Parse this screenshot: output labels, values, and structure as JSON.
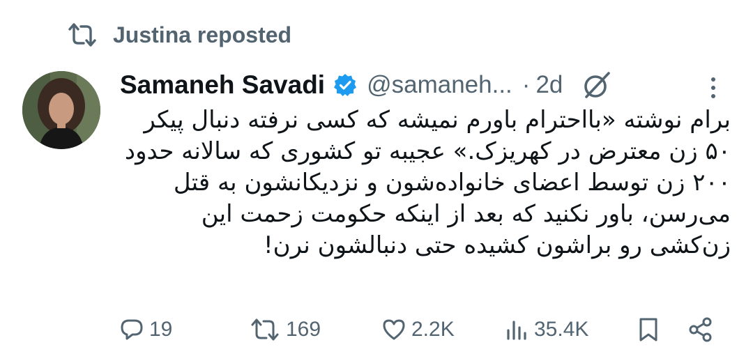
{
  "repost": {
    "icon": "repost-icon",
    "label": "Justina reposted"
  },
  "tweet": {
    "author": {
      "display_name": "Samaneh Savadi",
      "verified": true,
      "handle": "@samaneh...",
      "avatar": "avatar"
    },
    "separator": "·",
    "time": "2d",
    "text": "برام نوشته «بااحترام باورم نمیشه که کسی نرفته دنبال پیکر ۵۰ زن معترض در کهریزک.» عجیبه تو کشوری که سالانه حدود ۲۰۰ زن توسط اعضای خانواده‌شون و نزدیکانشون به قتل می‌رسن، باور نکنید که بعد از اینکه حکومت زحمت این زن‌کشی رو براشون کشیده حتی دنبالشون نرن!",
    "actions": {
      "reply_count": "19",
      "repost_count": "169",
      "like_count": "2.2K",
      "views_count": "35.4K"
    }
  },
  "colors": {
    "primary_text": "#0f1419",
    "secondary_text": "#536471",
    "verified_blue": "#1d9bf0"
  }
}
